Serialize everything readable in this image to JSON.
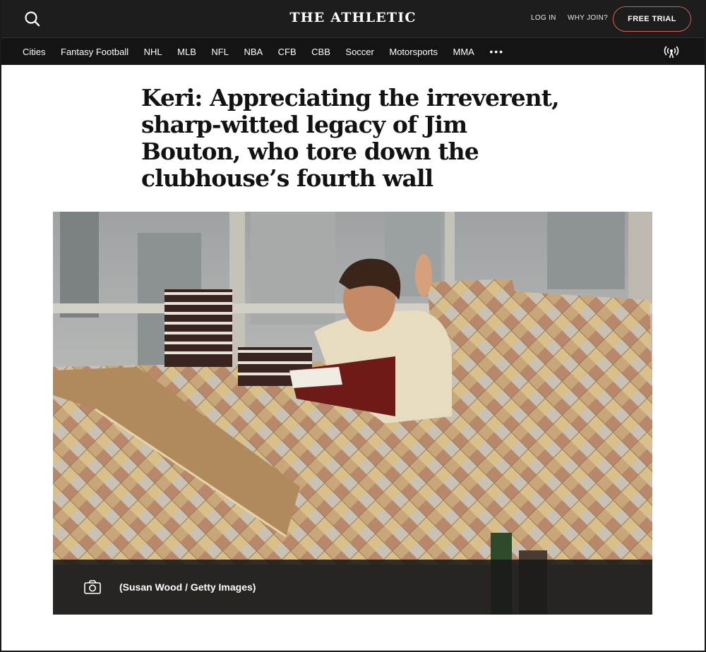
{
  "header": {
    "brand": "THE ATHLETIC",
    "login_label": "LOG IN",
    "why_join_label": "WHY JOIN?",
    "free_trial_label": "FREE TRIAL",
    "accent_color": "#d4624a"
  },
  "nav": {
    "items": [
      "Cities",
      "Fantasy Football",
      "NHL",
      "MLB",
      "NFL",
      "NBA",
      "CFB",
      "CBB",
      "Soccer",
      "Motorsports",
      "MMA"
    ],
    "more_label": "•••",
    "more_icon": "more-dots-icon",
    "live_icon": "broadcast-icon"
  },
  "article": {
    "headline": "Keri: Appreciating the irreverent, sharp-witted legacy of Jim Bouton, who tore down the clubhouse’s fourth wall",
    "image_caption": "(Susan Wood / Getty Images)",
    "caption_icon": "camera-icon"
  }
}
